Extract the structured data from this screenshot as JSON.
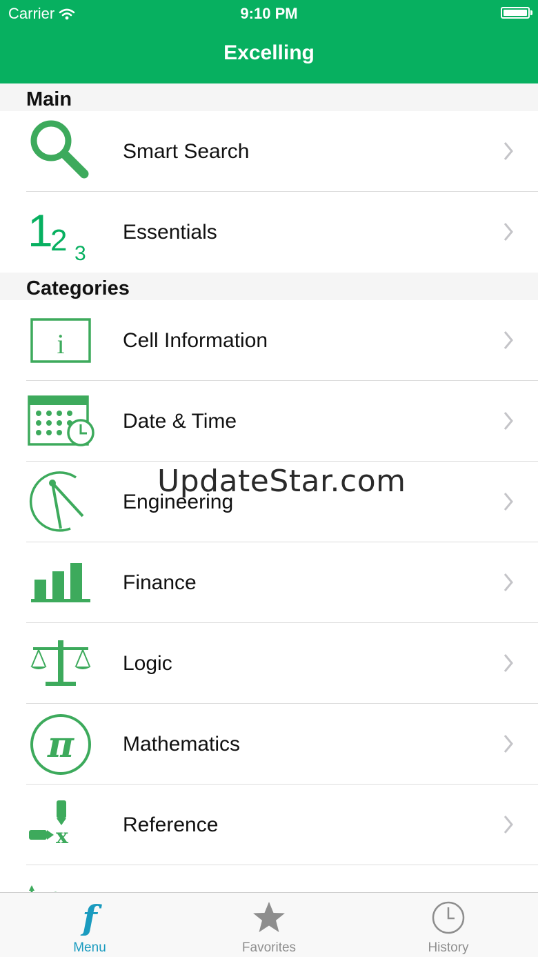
{
  "status_bar": {
    "carrier": "Carrier",
    "time": "9:10 PM"
  },
  "nav": {
    "title": "Excelling"
  },
  "sections": [
    {
      "title": "Main",
      "items": [
        {
          "label": "Smart Search",
          "icon": "search-icon"
        },
        {
          "label": "Essentials",
          "icon": "numbers-123-icon",
          "icon_text": [
            "1",
            "2",
            "3"
          ]
        }
      ]
    },
    {
      "title": "Categories",
      "items": [
        {
          "label": "Cell Information",
          "icon": "info-box-icon",
          "icon_text": "i"
        },
        {
          "label": "Date & Time",
          "icon": "calendar-clock-icon"
        },
        {
          "label": "Engineering",
          "icon": "compass-icon"
        },
        {
          "label": "Finance",
          "icon": "bar-chart-icon"
        },
        {
          "label": "Logic",
          "icon": "scales-icon"
        },
        {
          "label": "Mathematics",
          "icon": "pi-icon",
          "icon_text": "π"
        },
        {
          "label": "Reference",
          "icon": "reference-icon",
          "icon_text": "x"
        }
      ]
    }
  ],
  "watermark": "UpdateStar.com",
  "tabbar": {
    "tabs": [
      {
        "label": "Menu",
        "icon": "function-icon",
        "icon_text": "f"
      },
      {
        "label": "Favorites",
        "icon": "star-icon"
      },
      {
        "label": "History",
        "icon": "clock-icon"
      }
    ]
  },
  "colors": {
    "accent": "#07b060",
    "icon_green": "#3daa5c",
    "tab_active": "#1a9bbf",
    "tab_inactive": "#8e8e8e"
  }
}
